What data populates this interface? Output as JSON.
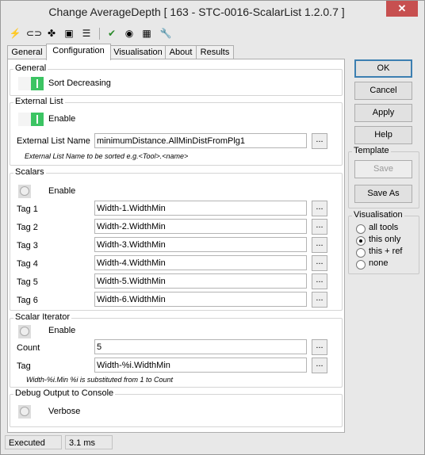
{
  "window": {
    "title": "Change AverageDepth [ 163 - STC-0016-ScalarList 1.2.0.7 ]",
    "close_label": "✕"
  },
  "toolbar": {
    "icons": [
      "lightning-icon",
      "link-icon",
      "puzzle-icon",
      "console-icon",
      "list-icon",
      "check-icon",
      "camera-icon",
      "overlay-icon",
      "wrench-icon"
    ]
  },
  "tabs": [
    "General",
    "Configuration",
    "Visualisation",
    "About",
    "Results"
  ],
  "active_tab": "Configuration",
  "general": {
    "title": "General",
    "sort_label": "Sort Decreasing",
    "sort_on": true
  },
  "external_list": {
    "title": "External List",
    "enable_label": "Enable",
    "enable_on": true,
    "name_label": "External List Name",
    "name_value": "minimumDistance.AllMinDistFromPlg1",
    "hint": "External List Name to be sorted e.g.<Tool>.<name>",
    "dots": "..."
  },
  "scalars": {
    "title": "Scalars",
    "enable_label": "Enable",
    "enable_on": false,
    "tags": [
      {
        "label": "Tag 1",
        "value": "Width-1.WidthMin"
      },
      {
        "label": "Tag 2",
        "value": "Width-2.WidthMin"
      },
      {
        "label": "Tag 3",
        "value": "Width-3.WidthMin"
      },
      {
        "label": "Tag 4",
        "value": "Width-4.WidthMin"
      },
      {
        "label": "Tag 5",
        "value": "Width-5.WidthMin"
      },
      {
        "label": "Tag 6",
        "value": "Width-6.WidthMin"
      }
    ]
  },
  "scalar_iterator": {
    "title": "Scalar Iterator",
    "enable_label": "Enable",
    "enable_on": false,
    "count_label": "Count",
    "count_value": "5",
    "tag_label": "Tag",
    "tag_value": "Width-%i.WidthMin",
    "hint": "Width-%i.Min   %i is substituted from 1 to Count"
  },
  "debug": {
    "title": "Debug Output to Console",
    "verbose_label": "Verbose",
    "verbose_on": false
  },
  "buttons": {
    "ok": "OK",
    "cancel": "Cancel",
    "apply": "Apply",
    "help": "Help"
  },
  "template": {
    "title": "Template",
    "save": "Save",
    "save_as": "Save As"
  },
  "visualisation": {
    "title": "Visualisation",
    "options": [
      "all tools",
      "this only",
      "this + ref",
      "none"
    ],
    "selected": "this only"
  },
  "status": {
    "state": "Executed",
    "time": "3.1 ms"
  }
}
